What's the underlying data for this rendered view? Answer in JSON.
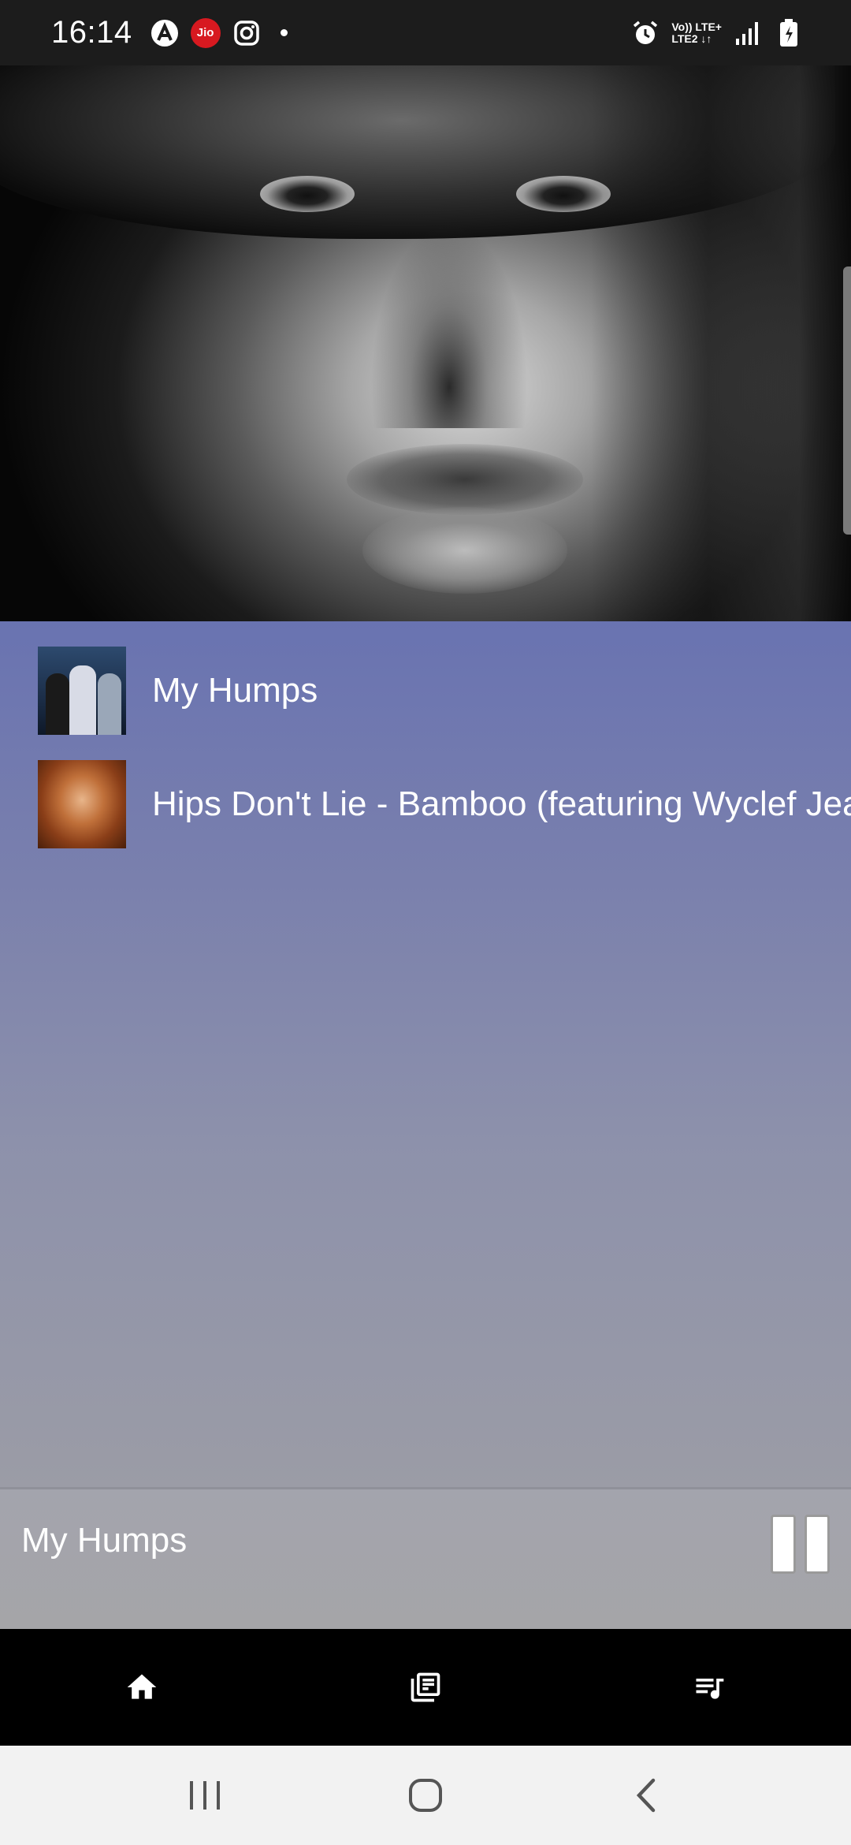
{
  "status_bar": {
    "time": "16:14",
    "left_icons": [
      "assistant-icon",
      "jio-icon",
      "instagram-icon",
      "notification-dot"
    ],
    "jio_label": "Jio",
    "network_line1": "Vo)) LTE+",
    "network_line2": "LTE2 ↓↑",
    "right_icons": [
      "alarm-icon",
      "signal-icon",
      "battery-icon"
    ]
  },
  "hero": {
    "image": "artist-portrait"
  },
  "songs": [
    {
      "title": "My Humps",
      "thumbnail": "album-art-my-humps"
    },
    {
      "title": "Hips Don't Lie - Bamboo (featuring Wyclef Jean)",
      "thumbnail": "album-art-hips-dont-lie"
    }
  ],
  "mini_player": {
    "title": "My Humps",
    "control": "pause-icon"
  },
  "bottom_nav": {
    "items": [
      {
        "name": "home",
        "icon": "home-icon"
      },
      {
        "name": "library",
        "icon": "library-icon"
      },
      {
        "name": "queue",
        "icon": "queue-music-icon"
      }
    ]
  },
  "system_nav": {
    "buttons": [
      "recents-icon",
      "home-circle-icon",
      "back-icon"
    ]
  },
  "colors": {
    "status_bar": "#1c1c1c",
    "list_gradient_top": "#6973b1",
    "list_gradient_bottom": "#9b9ca6",
    "mini_player": "#a5a5a8",
    "bottom_nav": "#000000",
    "system_nav": "#f2f2f2",
    "jio_red": "#d71920"
  }
}
